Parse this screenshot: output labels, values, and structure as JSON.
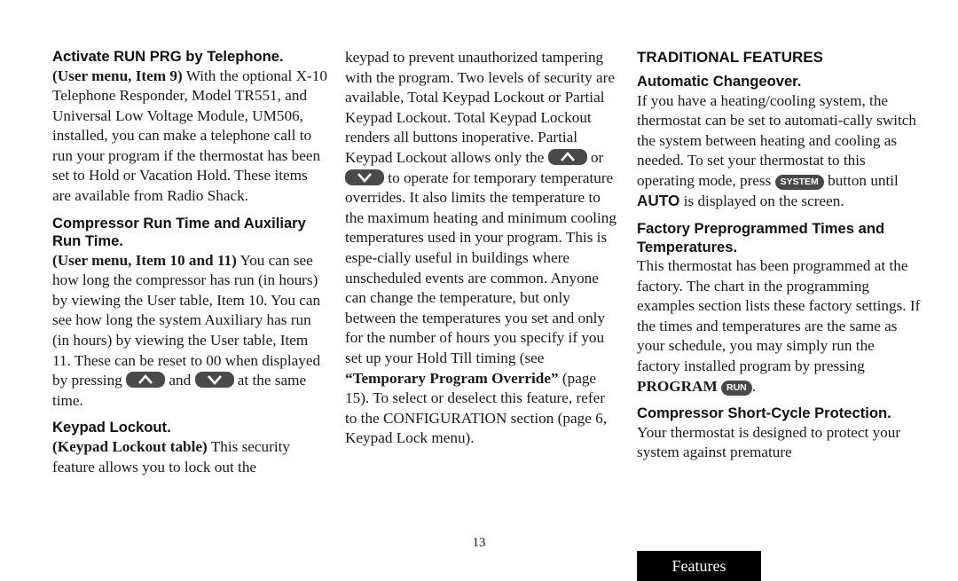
{
  "page_number": "13",
  "section_tab": "Features",
  "icons": {
    "up": "up-arrow-button",
    "down": "down-arrow-button"
  },
  "col1": {
    "s1": {
      "heading": "Activate RUN PRG by Telephone.",
      "ref": "(User menu, Item 9)",
      "text": " With the optional X-10 Telephone Responder, Model TR551, and Universal Low Voltage Module, UM506, installed, you can make a telephone call to run your program if the thermostat has been set to Hold or Vacation Hold. These items are available from Radio Shack."
    },
    "s2": {
      "heading": "Compressor Run Time and Auxiliary Run Time.",
      "ref": "(User menu, Item 10 and 11)",
      "text": " You can see how long the compressor has run (in hours) by viewing the User table, Item 10.  You can see how long the system Auxiliary has run (in hours) by viewing the User table, Item 11. These can be reset to 00 when displayed by pressing",
      "and": " and ",
      "tail": " at the same time."
    },
    "s3": {
      "heading": "Keypad Lockout.",
      "ref": "(Keypad Lockout table)",
      "text": " This security feature allows you to lock out the"
    }
  },
  "col2": {
    "text1": "keypad to prevent unauthorized tampering with the program. Two levels of security are available, Total Keypad Lockout or Partial Keypad Lockout. Total Keypad Lockout renders all buttons inoperative. Partial Keypad Lockout allows only the ",
    "or": " or ",
    "text2": " to operate for temporary temperature overrides. It also limits the temperature to the maximum heating and minimum cooling temperatures used in your program. This is espe-cially useful in buildings where unscheduled events are common. Anyone can change the temperature, but only between the temperatures you set and only for the number of hours you specify if you set up your Hold Till timing (see ",
    "bold_ref": "“Temporary Program Override”",
    "text3": " (page 15). To select or deselect this feature, refer to the CONFIGURATION section (page 6, Keypad Lock menu)."
  },
  "col3": {
    "section_title": "TRADITIONAL FEATURES",
    "s1": {
      "heading": "Automatic Changeover.",
      "text": "If you have a heating/cooling system, the thermostat can be set to automati-cally switch the system between heating and cooling as needed. To set your thermostat to this operating mode, ",
      "press": "press ",
      "button": "SYSTEM",
      "mid": " button until ",
      "mode": "AUTO",
      "tail": " is displayed on the screen."
    },
    "s2": {
      "heading": "Factory Preprogrammed Times and Temperatures.",
      "text": "This thermostat has been programmed at the factory. The chart in the programming examples section lists these factory settings. If the times and temperatures are the same as your schedule, you may simply run the factory installed program by pressing ",
      "program": "PROGRAM",
      "button": "RUN",
      "tail": "."
    },
    "s3": {
      "heading": "Compressor Short-Cycle Protection.",
      "text": "Your thermostat is designed to protect your system against premature"
    }
  }
}
